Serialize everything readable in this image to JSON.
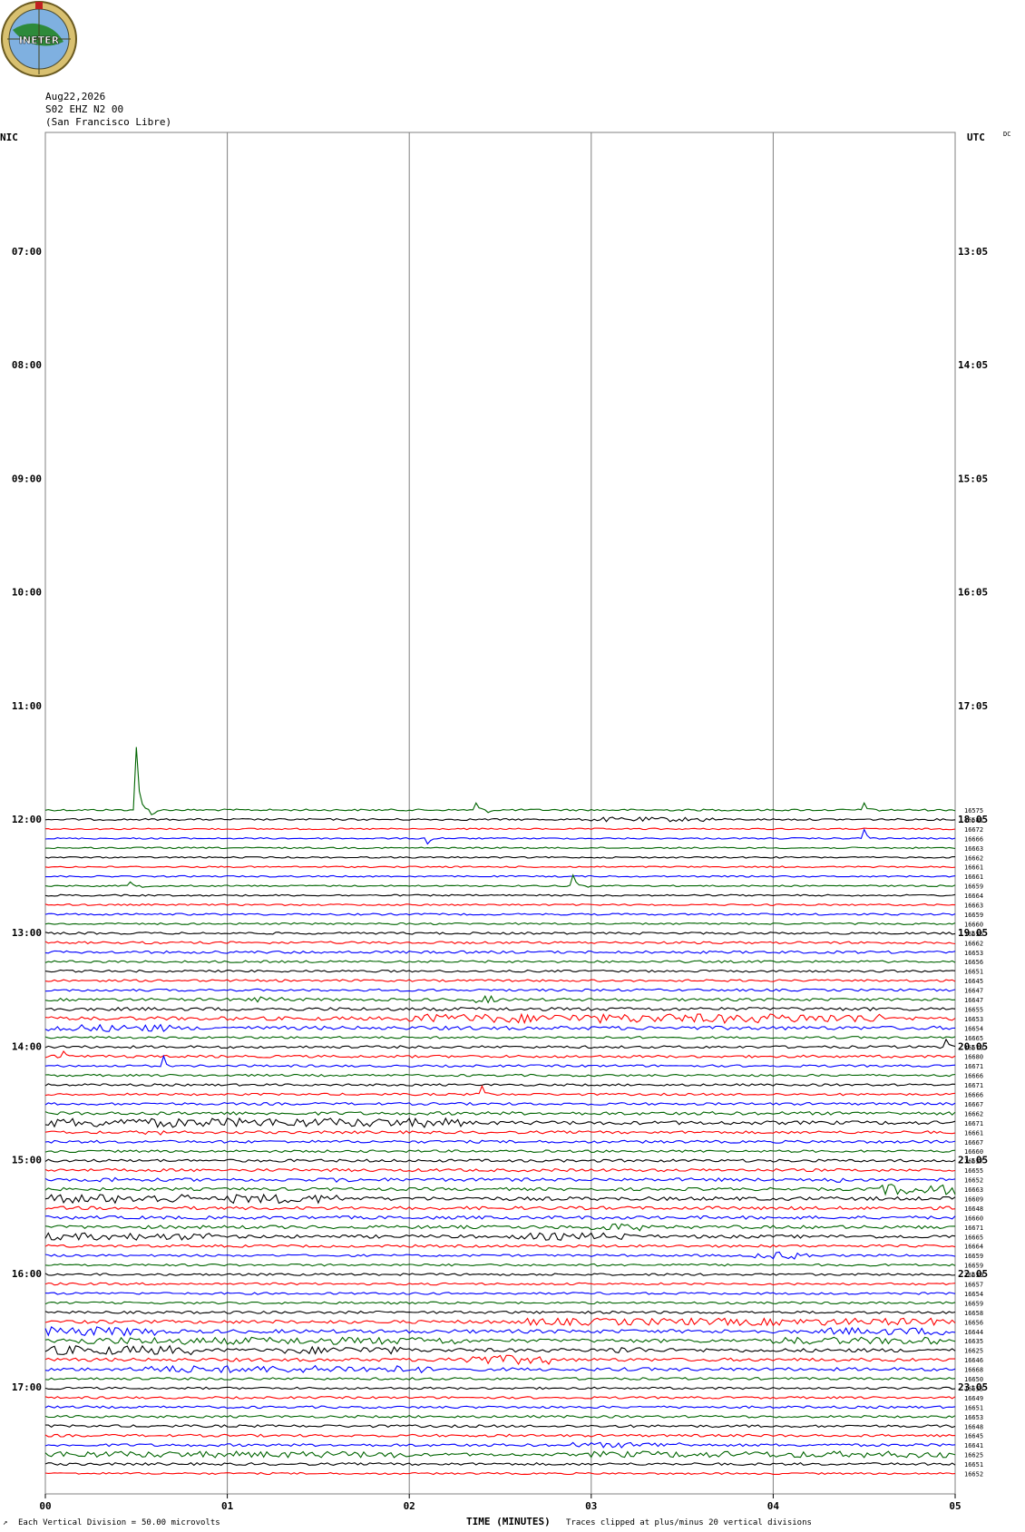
{
  "header": {
    "logo_text": "INETER",
    "date": "Aug22,2026",
    "station": "S02 EHZ N2 00",
    "location": "(San Francisco Libre)",
    "left_tz": "NIC",
    "right_tz": "UTC",
    "dc_label": "DC"
  },
  "footer": {
    "left_mark": "↗",
    "vertical_division": "Each Vertical Division =",
    "vertical_value": "50.00 microvolts",
    "xaxis_title": "TIME (MINUTES)",
    "clip_note": "Traces clipped at plus/minus 20 vertical divisions"
  },
  "colors": {
    "black": "#000000",
    "red": "#ff0000",
    "blue": "#0000ff",
    "green": "#006400",
    "grid": "#808080"
  },
  "chart_data": {
    "type": "line",
    "title": "",
    "xlabel": "TIME (MINUTES)",
    "x_ticks": [
      "00",
      "01",
      "02",
      "03",
      "04",
      "05"
    ],
    "xlim": [
      0,
      5
    ],
    "hour_labels_left": [
      "07:00",
      "08:00",
      "09:00",
      "10:00",
      "11:00",
      "12:00",
      "13:00",
      "14:00",
      "15:00",
      "16:00",
      "17:00"
    ],
    "hour_labels_right": [
      "13:05",
      "14:05",
      "15:05",
      "16:05",
      "17:05",
      "18:05",
      "19:05",
      "20:05",
      "21:05",
      "22:05",
      "23:05"
    ],
    "trace_color_cycle": [
      "green",
      "black",
      "red",
      "blue"
    ],
    "traces": [
      {
        "label": "16575",
        "amp": 1.0,
        "events": [
          [
            0.5,
            -70
          ],
          [
            2.35,
            -25
          ],
          [
            4.5,
            -8
          ]
        ]
      },
      {
        "label": "16681",
        "amp": 1.0,
        "bursts": [
          [
            3.0,
            3.7,
            2.5
          ]
        ]
      },
      {
        "label": "16672",
        "amp": 0.8
      },
      {
        "label": "16666",
        "amp": 0.8,
        "events": [
          [
            2.1,
            6
          ],
          [
            4.5,
            -10
          ]
        ]
      },
      {
        "label": "16663",
        "amp": 0.8
      },
      {
        "label": "16662",
        "amp": 0.8
      },
      {
        "label": "16661",
        "amp": 0.8
      },
      {
        "label": "16661",
        "amp": 0.8
      },
      {
        "label": "16659",
        "amp": 0.8,
        "events": [
          [
            0.45,
            -16
          ],
          [
            2.9,
            -12
          ]
        ]
      },
      {
        "label": "16664",
        "amp": 0.9
      },
      {
        "label": "16663",
        "amp": 0.9
      },
      {
        "label": "16659",
        "amp": 1.0
      },
      {
        "label": "16660",
        "amp": 1.0
      },
      {
        "label": "16655",
        "amp": 1.2
      },
      {
        "label": "16662",
        "amp": 1.3
      },
      {
        "label": "16653",
        "amp": 1.4
      },
      {
        "label": "16656",
        "amp": 1.2
      },
      {
        "label": "16651",
        "amp": 1.2
      },
      {
        "label": "16645",
        "amp": 1.2
      },
      {
        "label": "16647",
        "amp": 1.3
      },
      {
        "label": "16647",
        "amp": 1.5,
        "bursts": [
          [
            1.1,
            1.3,
            3
          ],
          [
            2.35,
            2.5,
            4
          ]
        ]
      },
      {
        "label": "16655",
        "amp": 1.8
      },
      {
        "label": "16653",
        "amp": 2.0,
        "bursts": [
          [
            2.0,
            4.6,
            5
          ]
        ]
      },
      {
        "label": "16654",
        "amp": 2.0,
        "bursts": [
          [
            0.0,
            0.7,
            4
          ]
        ]
      },
      {
        "label": "16665",
        "amp": 1.2
      },
      {
        "label": "16670",
        "amp": 1.4,
        "events": [
          [
            4.95,
            -8
          ]
        ]
      },
      {
        "label": "16680",
        "amp": 1.4,
        "events": [
          [
            0.1,
            -6
          ]
        ]
      },
      {
        "label": "16671",
        "amp": 1.2,
        "events": [
          [
            0.65,
            -10
          ]
        ]
      },
      {
        "label": "16666",
        "amp": 1.2
      },
      {
        "label": "16671",
        "amp": 1.2
      },
      {
        "label": "16666",
        "amp": 1.2,
        "events": [
          [
            2.4,
            -8
          ]
        ]
      },
      {
        "label": "16667",
        "amp": 1.4
      },
      {
        "label": "16662",
        "amp": 1.8
      },
      {
        "label": "16671",
        "amp": 2.0,
        "bursts": [
          [
            0.0,
            2.3,
            5
          ]
        ]
      },
      {
        "label": "16661",
        "amp": 1.5,
        "bursts": [
          [
            0.55,
            0.7,
            3
          ]
        ]
      },
      {
        "label": "16667",
        "amp": 1.5
      },
      {
        "label": "16660",
        "amp": 1.3
      },
      {
        "label": "16657",
        "amp": 1.5
      },
      {
        "label": "16655",
        "amp": 1.6
      },
      {
        "label": "16652",
        "amp": 1.8,
        "bursts": [
          [
            0.3,
            0.4,
            3
          ],
          [
            1.6,
            1.7,
            3
          ],
          [
            4.25,
            4.4,
            3
          ]
        ]
      },
      {
        "label": "16663",
        "amp": 1.6,
        "bursts": [
          [
            4.6,
            5.0,
            6
          ]
        ]
      },
      {
        "label": "16609",
        "amp": 2.0,
        "bursts": [
          [
            0.0,
            0.8,
            5
          ],
          [
            1.0,
            1.6,
            5
          ]
        ]
      },
      {
        "label": "16648",
        "amp": 1.8
      },
      {
        "label": "16660",
        "amp": 1.8
      },
      {
        "label": "16671",
        "amp": 1.8,
        "bursts": [
          [
            3.0,
            3.3,
            4
          ]
        ]
      },
      {
        "label": "16665",
        "amp": 1.8,
        "bursts": [
          [
            0.0,
            0.9,
            4
          ],
          [
            2.6,
            3.2,
            4
          ]
        ]
      },
      {
        "label": "16664",
        "amp": 1.4
      },
      {
        "label": "16659",
        "amp": 1.2,
        "bursts": [
          [
            3.9,
            4.2,
            4
          ]
        ]
      },
      {
        "label": "16659",
        "amp": 1.2
      },
      {
        "label": "16659",
        "amp": 1.2
      },
      {
        "label": "16657",
        "amp": 1.2
      },
      {
        "label": "16654",
        "amp": 1.2
      },
      {
        "label": "16659",
        "amp": 1.2
      },
      {
        "label": "16658",
        "amp": 1.4
      },
      {
        "label": "16656",
        "amp": 1.8,
        "bursts": [
          [
            2.6,
            5.0,
            4
          ]
        ]
      },
      {
        "label": "16644",
        "amp": 2.0,
        "bursts": [
          [
            0.0,
            0.6,
            5
          ],
          [
            4.3,
            5.0,
            4
          ]
        ]
      },
      {
        "label": "16635",
        "amp": 2.0,
        "bursts": [
          [
            0.0,
            2.3,
            4
          ],
          [
            4.0,
            4.9,
            4
          ]
        ]
      },
      {
        "label": "16625",
        "amp": 2.0,
        "bursts": [
          [
            0.0,
            0.8,
            5
          ],
          [
            1.3,
            2.0,
            4
          ],
          [
            3.1,
            3.3,
            4
          ]
        ]
      },
      {
        "label": "16646",
        "amp": 1.8,
        "bursts": [
          [
            2.2,
            2.8,
            5
          ]
        ]
      },
      {
        "label": "16668",
        "amp": 1.8,
        "bursts": [
          [
            0.5,
            2.1,
            4
          ]
        ]
      },
      {
        "label": "16650",
        "amp": 1.3
      },
      {
        "label": "16653",
        "amp": 1.2
      },
      {
        "label": "16649",
        "amp": 1.2
      },
      {
        "label": "16651",
        "amp": 1.3
      },
      {
        "label": "16653",
        "amp": 1.3
      },
      {
        "label": "16648",
        "amp": 1.4
      },
      {
        "label": "16645",
        "amp": 1.4
      },
      {
        "label": "16641",
        "amp": 1.5,
        "bursts": [
          [
            2.9,
            3.5,
            3
          ]
        ]
      },
      {
        "label": "16625",
        "amp": 1.6,
        "bursts": [
          [
            0.0,
            2.0,
            3.5
          ],
          [
            3.0,
            5.0,
            3.5
          ]
        ]
      },
      {
        "label": "16651",
        "amp": 1.4
      },
      {
        "label": "16652",
        "amp": 1.0
      }
    ]
  }
}
